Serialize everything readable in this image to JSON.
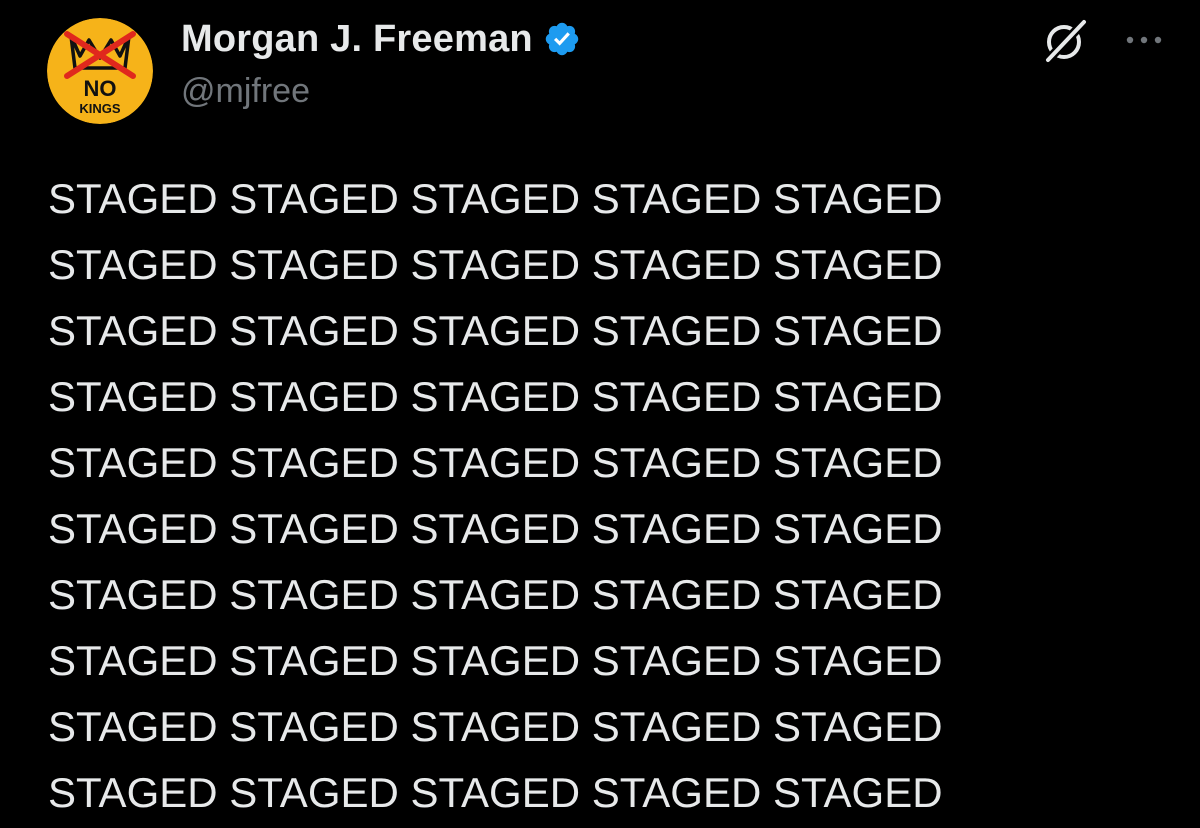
{
  "post": {
    "author": {
      "display_name": "Morgan J. Freeman",
      "handle": "@mjfree",
      "verified": true,
      "avatar": {
        "icon": "no-kings-crown-icon",
        "text_top": "NO",
        "text_bottom": "KINGS",
        "background_color": "#f6b319"
      }
    },
    "actions": {
      "grok_icon": "grok-icon",
      "more_icon": "more-dots-icon"
    },
    "text": "STAGED STAGED STAGED STAGED STAGED\nSTAGED STAGED STAGED STAGED STAGED\nSTAGED STAGED STAGED STAGED STAGED\nSTAGED STAGED STAGED STAGED STAGED\nSTAGED STAGED STAGED STAGED STAGED\nSTAGED STAGED STAGED STAGED STAGED\nSTAGED STAGED STAGED STAGED STAGED\nSTAGED STAGED STAGED STAGED STAGED\nSTAGED STAGED STAGED STAGED STAGED\nSTAGED STAGED STAGED STAGED STAGED"
  },
  "colors": {
    "background": "#000000",
    "primary_text": "#e7e9ea",
    "secondary_text": "#71767b",
    "verified_badge": "#1d9bf0"
  }
}
